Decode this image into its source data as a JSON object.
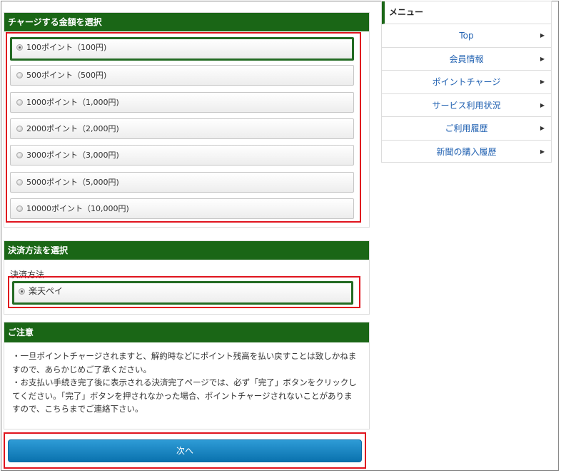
{
  "charge": {
    "title": "チャージする金額を選択",
    "options": [
      {
        "label": "100ポイント（100円)",
        "selected": true
      },
      {
        "label": "500ポイント（500円)",
        "selected": false
      },
      {
        "label": "1000ポイント（1,000円)",
        "selected": false
      },
      {
        "label": "2000ポイント（2,000円)",
        "selected": false
      },
      {
        "label": "3000ポイント（3,000円)",
        "selected": false
      },
      {
        "label": "5000ポイント（5,000円)",
        "selected": false
      },
      {
        "label": "10000ポイント（10,000円)",
        "selected": false
      }
    ]
  },
  "payment": {
    "title": "決済方法を選択",
    "label": "決済方法",
    "option": {
      "label": "楽天ペイ",
      "selected": true
    }
  },
  "notice": {
    "title": "ご注意",
    "lines": [
      "・一旦ポイントチャージされますと、解約時などにポイント残高を払い戻すことは致しかねますので、あらかじめご了承ください。",
      "・お支払い手続き完了後に表示される決済完了ページでは、必ず「完了」ボタンをクリックしてください。「完了」ボタンを押されなかった場合、ポイントチャージされないことがありますので、こちらまでご連絡下さい。"
    ]
  },
  "next_button": "次へ",
  "menu": {
    "title": "メニュー",
    "items": [
      {
        "label": "Top"
      },
      {
        "label": "会員情報"
      },
      {
        "label": "ポイントチャージ"
      },
      {
        "label": "サービス利用状況"
      },
      {
        "label": "ご利用履歴"
      },
      {
        "label": "新聞の購入履歴"
      }
    ],
    "arrow": "▶"
  },
  "colors": {
    "header_green": "#1a6616",
    "highlight_red": "#e0141e",
    "link_blue": "#2262b2",
    "button_blue": "#0a72ae"
  }
}
